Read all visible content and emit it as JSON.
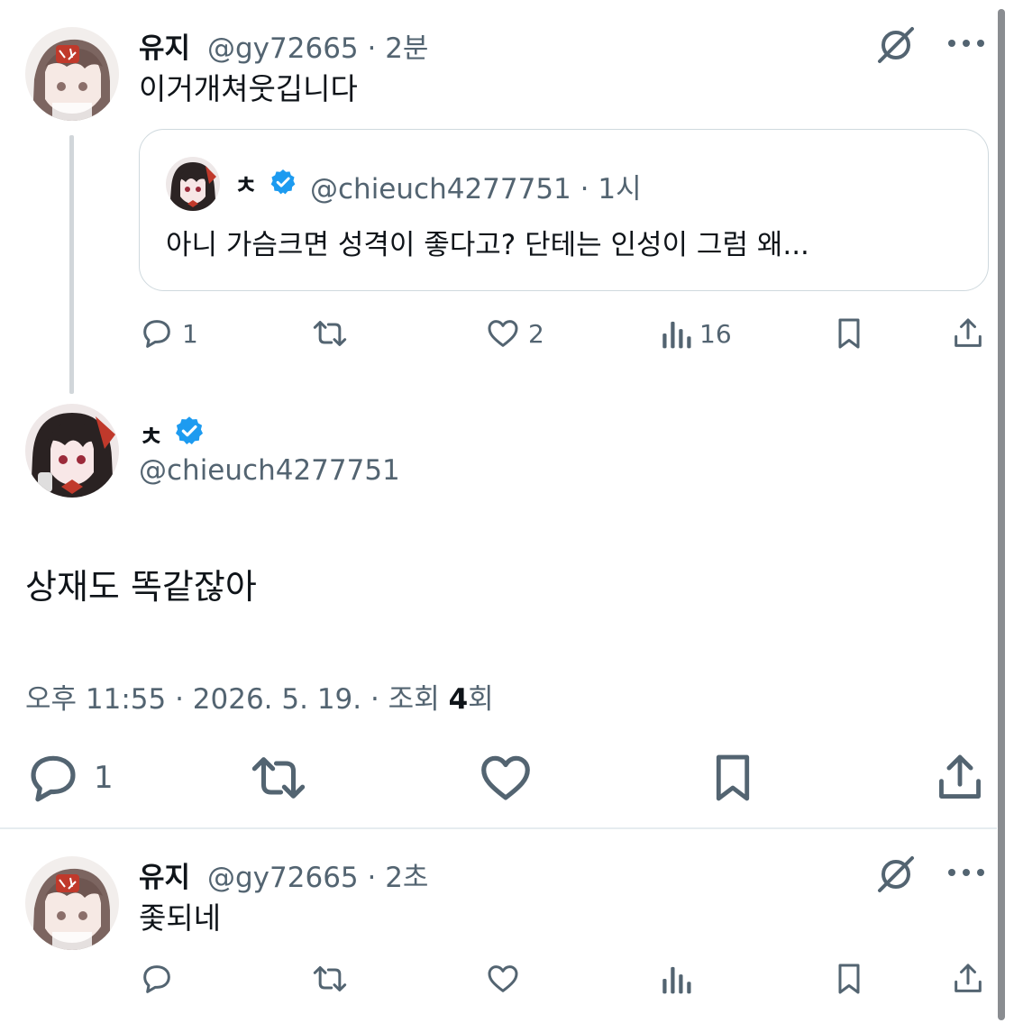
{
  "tweet1": {
    "name": "유지",
    "handle": "@gy72665 · 2분",
    "text": "이거개쳐웃깁니다",
    "quote": {
      "name": "ㅊ",
      "handle": "@chieuch4277751 · 1시",
      "text": "아니 가슴크면 성격이 좋다고? 단테는 인성이 그럼 왜..."
    },
    "actions": {
      "replies": "1",
      "likes": "2",
      "views": "16"
    }
  },
  "main_tweet": {
    "name": "ㅊ",
    "handle": "@chieuch4277751",
    "text": "상재도 똑같잖아",
    "time": "오후 11:55 · 2026. 5. 19. · 조회 ",
    "views": "4",
    "views_suffix": "회",
    "actions": {
      "replies": "1"
    }
  },
  "tweet3": {
    "name": "유지",
    "handle": "@gy72665 · 2초",
    "text": "좇되네"
  },
  "colors": {
    "text": "#0f1419",
    "secondary": "#536471",
    "verified": "#1d9bf0",
    "border": "#cfd9de",
    "thread_line": "#d1d6da"
  }
}
